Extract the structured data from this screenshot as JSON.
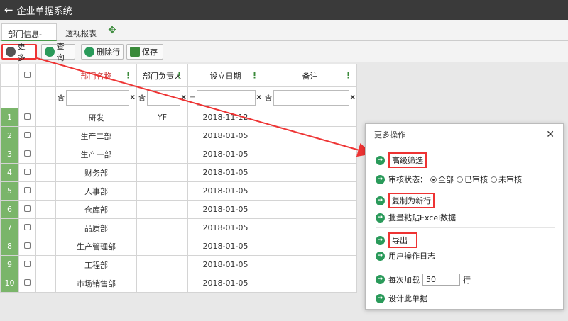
{
  "window": {
    "title": "企业单据系统",
    "back_icon": "arrow-left-icon"
  },
  "tabs": [
    {
      "label": "部门信息-ERP"
    },
    {
      "label": "透视报表"
    }
  ],
  "toolbar": {
    "more_label": "更多",
    "query_label": "查询",
    "delete_row_label": "删除行",
    "save_label": "保存"
  },
  "grid": {
    "columns": [
      "部门名称",
      "部门负责人",
      "设立日期",
      "备注"
    ],
    "filters": {
      "name_op": "含",
      "head_op": "含",
      "date_op": "=",
      "note_op": "含",
      "clear": "x"
    },
    "rows": [
      {
        "num": "1",
        "name": "研发",
        "head": "YF",
        "date": "2018-11-12",
        "note": ""
      },
      {
        "num": "2",
        "name": "生产二部",
        "head": "",
        "date": "2018-01-05",
        "note": ""
      },
      {
        "num": "3",
        "name": "生产一部",
        "head": "",
        "date": "2018-01-05",
        "note": ""
      },
      {
        "num": "4",
        "name": "财务部",
        "head": "",
        "date": "2018-01-05",
        "note": ""
      },
      {
        "num": "5",
        "name": "人事部",
        "head": "",
        "date": "2018-01-05",
        "note": ""
      },
      {
        "num": "6",
        "name": "仓库部",
        "head": "",
        "date": "2018-01-05",
        "note": ""
      },
      {
        "num": "7",
        "name": "品质部",
        "head": "",
        "date": "2018-01-05",
        "note": ""
      },
      {
        "num": "8",
        "name": "生产管理部",
        "head": "",
        "date": "2018-01-05",
        "note": ""
      },
      {
        "num": "9",
        "name": "工程部",
        "head": "",
        "date": "2018-01-05",
        "note": ""
      },
      {
        "num": "10",
        "name": "市场销售部",
        "head": "",
        "date": "2018-01-05",
        "note": ""
      }
    ]
  },
  "dialog": {
    "title": "更多操作",
    "close": "✕",
    "advanced_filter": "高级筛选",
    "audit_label": "审核状态：",
    "audit_options": [
      "全部",
      "已审核",
      "未审核"
    ],
    "copy_new_row": "复制为新行",
    "batch_paste": "批量粘贴Excel数据",
    "export": "导出",
    "user_log": "用户操作日志",
    "load_prefix": "每次加载",
    "load_value": "50",
    "load_suffix": "行",
    "design_doc": "设计此单据"
  }
}
